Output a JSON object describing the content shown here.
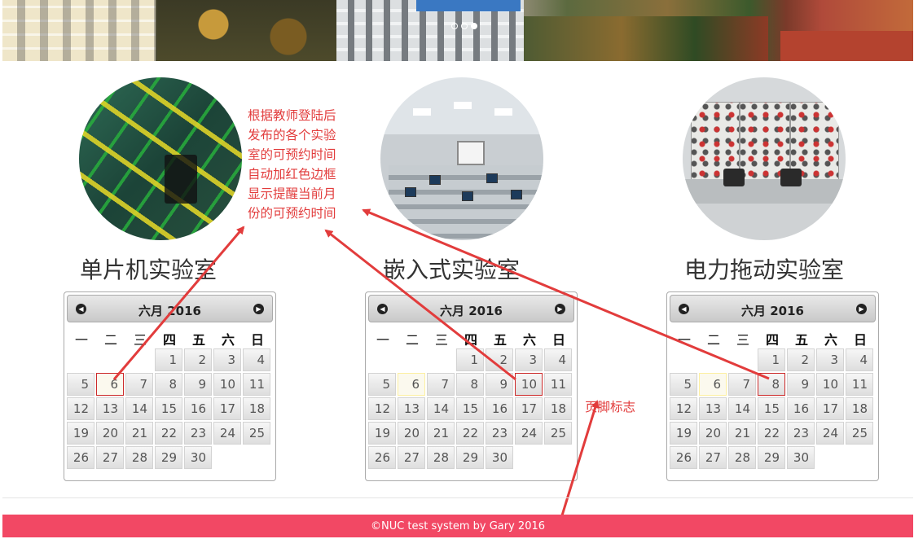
{
  "banner": {
    "slides": 3,
    "active_slide": 3
  },
  "labs": [
    {
      "name": "单片机实验室",
      "calendar": {
        "title": "六月 2016",
        "today": 6,
        "marked": [
          6
        ]
      }
    },
    {
      "name": "嵌入式实验室",
      "calendar": {
        "title": "六月 2016",
        "today": 6,
        "marked": [
          10
        ]
      }
    },
    {
      "name": "电力拖动实验室",
      "calendar": {
        "title": "六月 2016",
        "today": 6,
        "marked": [
          8
        ]
      }
    }
  ],
  "weekdays": [
    "一",
    "二",
    "三",
    "四",
    "五",
    "六",
    "日"
  ],
  "bold_weekdays": [
    "四",
    "五",
    "六",
    "日"
  ],
  "calendar_month": {
    "first_weekday_index": 2,
    "days": 30
  },
  "nav": {
    "prev_icon": "◀",
    "next_icon": "▶"
  },
  "annotations": {
    "main_lines": [
      "根据教师登陆后",
      "发布的各个实验",
      "室的可预约时间",
      "自动加红色边框",
      "显示提醒当前月",
      "份的可预约时间"
    ],
    "footer": "页脚标志"
  },
  "footer": {
    "text": "©NUC test system by Gary 2016",
    "color": "#f24864"
  },
  "colors": {
    "annotation": "#e23c3c",
    "marked_border": "#cc2a2a",
    "today_bg": "#fbf9ee"
  }
}
